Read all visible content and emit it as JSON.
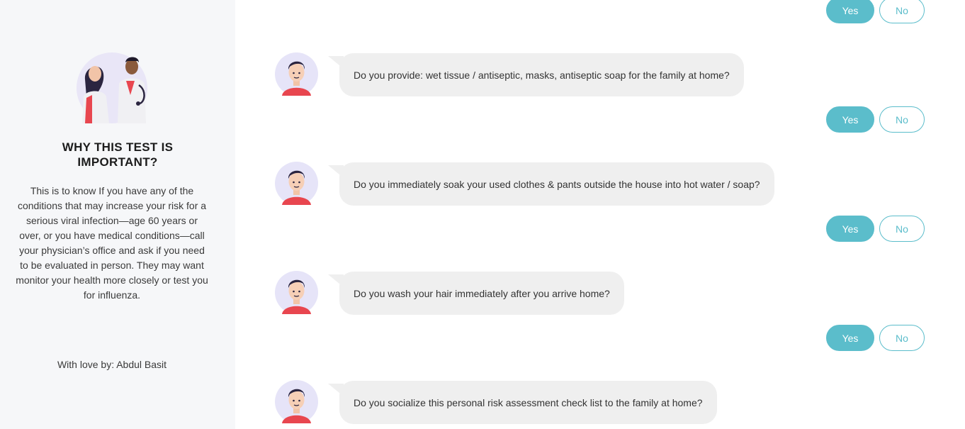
{
  "sidebar": {
    "title": "WHY THIS TEST IS IMPORTANT?",
    "description": "This is to know If you have any of the conditions that may increase your risk for a serious viral infection—age 60 years or over, or you have medical conditions—call your physician’s office and ask if you need to be evaluated in person. They may want monitor your health more closely or test you for influenza.",
    "credit": "With love by: Abdul Basit"
  },
  "answers": {
    "yes_label": "Yes",
    "no_label": "No"
  },
  "questions": [
    {
      "text": "Do you provide: wet tissue / antiseptic, masks, antiseptic soap for the family at home?"
    },
    {
      "text": "Do you immediately soak your used clothes & pants outside the house into hot water / soap?"
    },
    {
      "text": "Do you wash your hair immediately after you arrive home?"
    },
    {
      "text": "Do you socialize this personal risk assessment check list to the family at home?"
    }
  ],
  "colors": {
    "accent": "#5bbdcb",
    "bubble": "#efefef",
    "sidebar_bg": "#f6f7f9"
  }
}
